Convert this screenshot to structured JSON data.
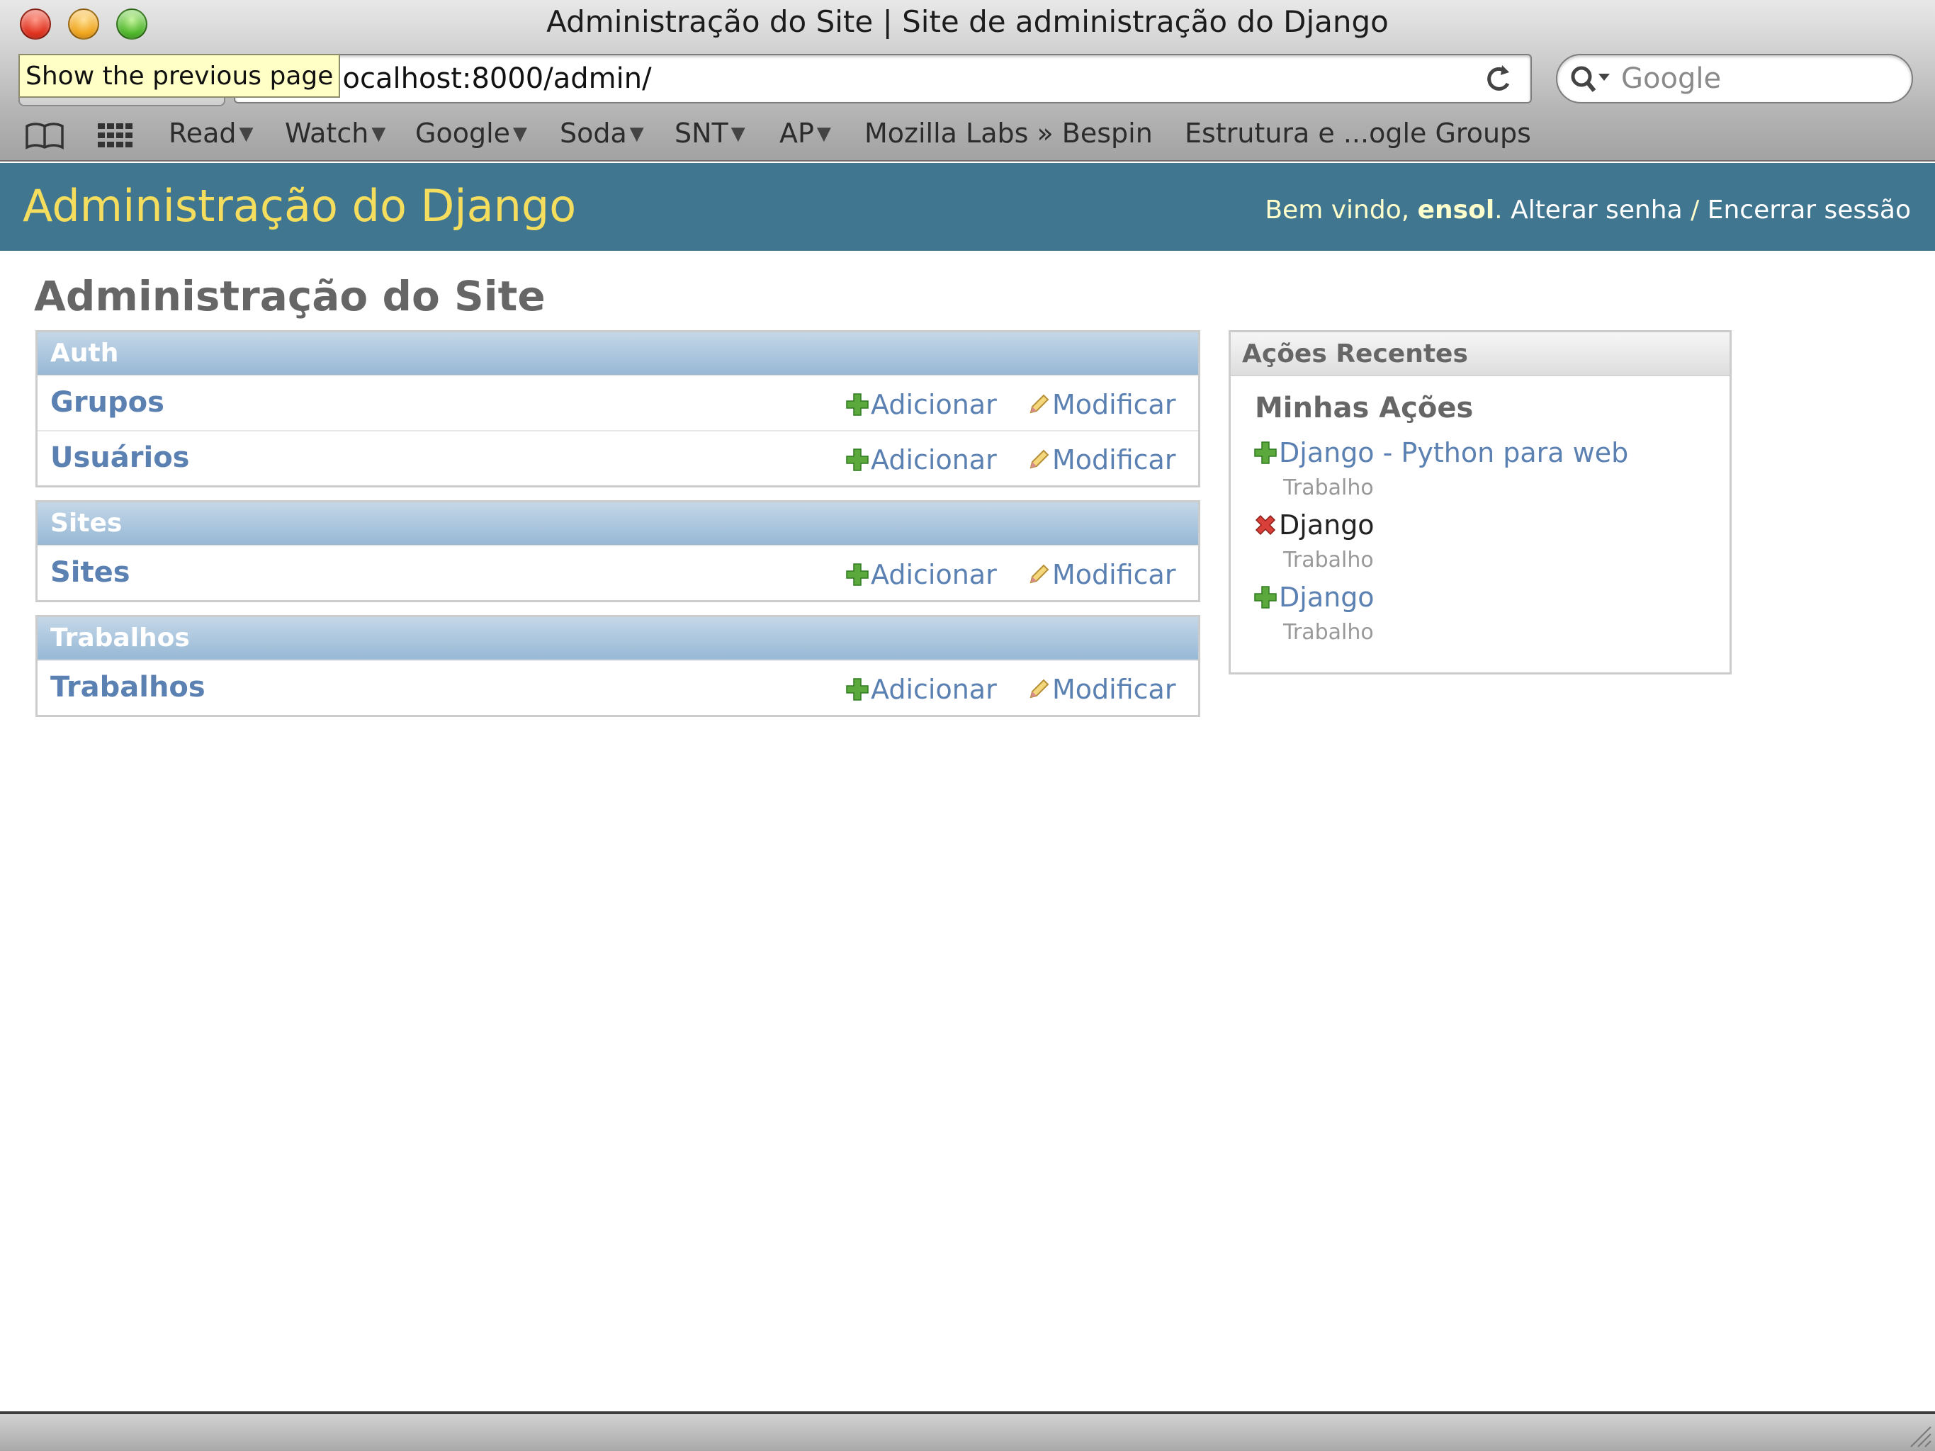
{
  "window": {
    "title": "Administração do Site | Site de administração do Django"
  },
  "toolbar": {
    "tooltip": "Show the previous page",
    "address_visible": "://localhost:8000/admin/",
    "search_placeholder": "Google"
  },
  "bookmarks": [
    {
      "label": "Read",
      "has_menu": true
    },
    {
      "label": "Watch",
      "has_menu": true
    },
    {
      "label": "Google",
      "has_menu": true
    },
    {
      "label": "Soda",
      "has_menu": true
    },
    {
      "label": "SNT",
      "has_menu": true
    },
    {
      "label": "AP",
      "has_menu": true
    },
    {
      "label": "Mozilla Labs » Bespin",
      "has_menu": false
    },
    {
      "label": "Estrutura e ...ogle Groups",
      "has_menu": false
    }
  ],
  "header": {
    "branding": "Administração do Django",
    "welcome": "Bem vindo,",
    "username": "ensol",
    "change_password": "Alterar senha",
    "separator": "/",
    "logout": "Encerrar sessão"
  },
  "content": {
    "title": "Administração do Site",
    "add_label": "Adicionar",
    "change_label": "Modificar",
    "modules": [
      {
        "caption": "Auth",
        "models": [
          "Grupos",
          "Usuários"
        ]
      },
      {
        "caption": "Sites",
        "models": [
          "Sites"
        ]
      },
      {
        "caption": "Trabalhos",
        "models": [
          "Trabalhos"
        ]
      }
    ]
  },
  "sidebar": {
    "caption": "Ações Recentes",
    "my_actions": "Minhas Ações",
    "actions": [
      {
        "icon": "add-icon",
        "label": "Django - Python para web",
        "type": "Trabalho"
      },
      {
        "icon": "delete-icon",
        "label": "Django",
        "type": "Trabalho"
      },
      {
        "icon": "add-icon",
        "label": "Django",
        "type": "Trabalho"
      }
    ]
  },
  "colors": {
    "header_bg": "#417690",
    "branding": "#f5dd5d",
    "link": "#5b80b2",
    "module_caption": "#97b8d5"
  }
}
